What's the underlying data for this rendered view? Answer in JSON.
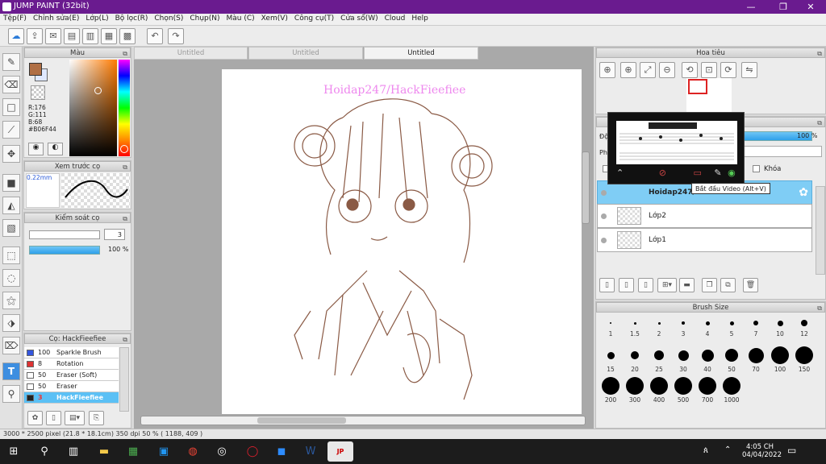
{
  "window": {
    "title": "JUMP PAINT (32bit)"
  },
  "menu": [
    "Tệp(F)",
    "Chỉnh sửa(E)",
    "Lớp(L)",
    "Bộ lọc(R)",
    "Chọn(S)",
    "Chụp(N)",
    "Màu (C)",
    "Xem(V)",
    "Công cụ(T)",
    "Cửa sổ(W)",
    "Cloud",
    "Help"
  ],
  "tabs": [
    "Untitled",
    "Untitled",
    "Untitled"
  ],
  "color_panel": {
    "title": "Màu",
    "r": "R:176",
    "g": "G:111",
    "b": "B:68",
    "hex": "#B06F44",
    "fg": "#b06f44"
  },
  "brush_preview": {
    "title": "Xem trước cọ",
    "size": "0.22mm"
  },
  "control_panel": {
    "title": "Kiểm soát cọ",
    "size_value": "3",
    "opacity": "100 %"
  },
  "brush_list": {
    "title": "Cọ: HackFieefiee",
    "items": [
      {
        "num": "100",
        "name": "Sparkle Brush",
        "color": "#3355dd"
      },
      {
        "num": "8",
        "name": "Rotation Symmetry",
        "color": "#dd3333"
      },
      {
        "num": "50",
        "name": "Eraser (Soft)",
        "color": "#ffffff"
      },
      {
        "num": "50",
        "name": "Eraser",
        "color": "#ffffff"
      },
      {
        "num": "3",
        "name": "HackFieefiee",
        "color": "#222222"
      }
    ]
  },
  "watermark": "Hoidap247/HackFieefiee",
  "navigator": {
    "title": "Hoa tiêu"
  },
  "layer_panel": {
    "opacity": "100 %",
    "lock": "Khóa",
    "label_do": "Độ",
    "label_ph": "Ph",
    "layers": [
      "Hoidap247/",
      "Lớp2",
      "Lớp1"
    ]
  },
  "tooltip": "Bắt đầu Video (Alt+V)",
  "brush_size": {
    "title": "Brush Size",
    "sizes": [
      "1",
      "1.5",
      "2",
      "3",
      "4",
      "5",
      "7",
      "10",
      "12",
      "15",
      "20",
      "25",
      "30",
      "40",
      "50",
      "70",
      "100",
      "150",
      "200",
      "300",
      "400",
      "500",
      "700",
      "1000"
    ]
  },
  "status": "3000 * 2500 pixel   (21.8 * 18.1cm)   350 dpi   50 %   ( 1188, 409 )",
  "clock": {
    "time": "4:05 CH",
    "date": "04/04/2022"
  }
}
